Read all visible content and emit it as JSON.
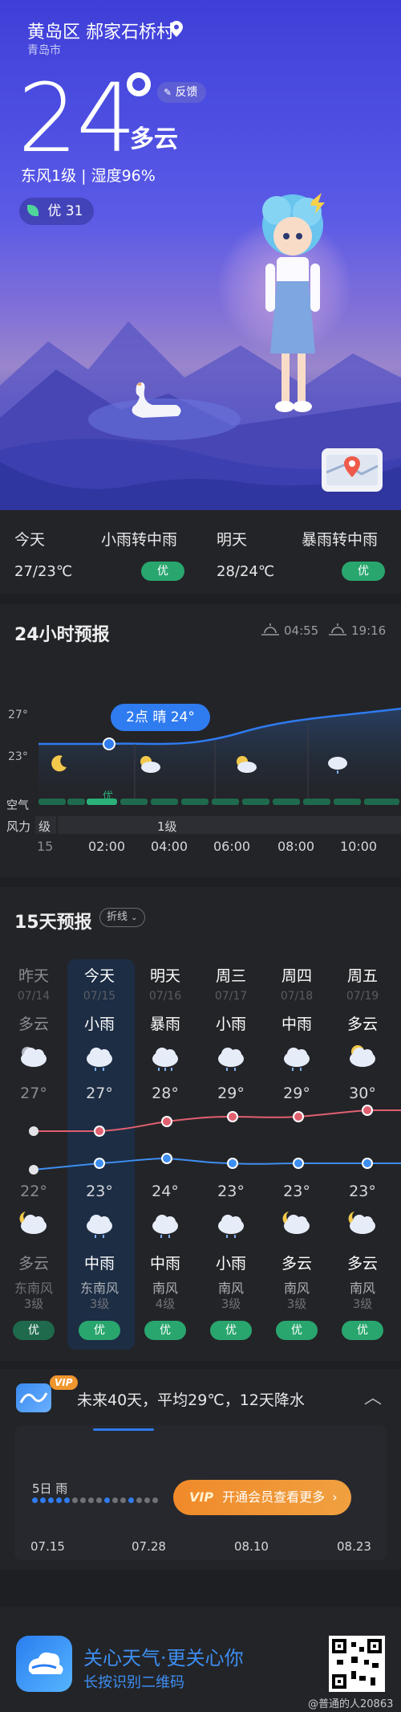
{
  "header": {
    "location": "黄岛区 郝家石桥村",
    "city": "青岛市",
    "temperature": "24",
    "condition": "多云",
    "feedback_label": "反馈",
    "wind_humidity": "东风1级 | 湿度96%",
    "aqi": "优 31"
  },
  "summary": {
    "today_label": "今天",
    "today_condition": "小雨转中雨",
    "today_temp": "27/23℃",
    "today_badge": "优",
    "tomorrow_label": "明天",
    "tomorrow_condition": "暴雨转中雨",
    "tomorrow_temp": "28/24℃",
    "tomorrow_badge": "优"
  },
  "hourly": {
    "title": "24小时预报",
    "sunrise": "04:55",
    "sunset": "19:16",
    "y_high": "27°",
    "y_low": "23°",
    "tooltip": "2点 晴 24°",
    "air_label": "空气",
    "air_value": "优",
    "wind_label": "风力",
    "wind_level_a": "级",
    "wind_level_b": "1级",
    "hours": [
      "15",
      "02:00",
      "04:00",
      "06:00",
      "08:00",
      "10:00"
    ]
  },
  "daily": {
    "title": "15天预报",
    "toggle_label": "折线",
    "days": [
      {
        "name": "昨天",
        "date": "07/14",
        "day_cond": "多云",
        "high": "27°",
        "low": "22°",
        "night_cond": "多云",
        "wind": "东南风",
        "level": "3级",
        "aqi": "优"
      },
      {
        "name": "今天",
        "date": "07/15",
        "day_cond": "小雨",
        "high": "27°",
        "low": "23°",
        "night_cond": "中雨",
        "wind": "东南风",
        "level": "3级",
        "aqi": "优"
      },
      {
        "name": "明天",
        "date": "07/16",
        "day_cond": "暴雨",
        "high": "28°",
        "low": "24°",
        "night_cond": "中雨",
        "wind": "南风",
        "level": "4级",
        "aqi": "优"
      },
      {
        "name": "周三",
        "date": "07/17",
        "day_cond": "小雨",
        "high": "29°",
        "low": "23°",
        "night_cond": "小雨",
        "wind": "南风",
        "level": "3级",
        "aqi": "优"
      },
      {
        "name": "周四",
        "date": "07/18",
        "day_cond": "中雨",
        "high": "29°",
        "low": "23°",
        "night_cond": "多云",
        "wind": "南风",
        "level": "3级",
        "aqi": "优"
      },
      {
        "name": "周五",
        "date": "07/19",
        "day_cond": "多云",
        "high": "30°",
        "low": "23°",
        "night_cond": "多云",
        "wind": "南风",
        "level": "3级",
        "aqi": "优"
      }
    ]
  },
  "forty_day": {
    "vip_badge": "VIP",
    "headline": "未来40天，平均29℃，12天降水",
    "rain_label": "5日 雨",
    "cta_vip": "VIP",
    "cta_label": "开通会员查看更多",
    "dates": [
      "07.15",
      "07.28",
      "08.10",
      "08.23"
    ]
  },
  "footer": {
    "slogan": "关心天气·更关心你",
    "hint": "长按识别二维码",
    "watermark": "@普通的人20863"
  },
  "colors": {
    "accent_blue": "#2f7bf0",
    "aqi_green": "#29a66e",
    "high_line": "#e06070",
    "low_line": "#3d8ef0",
    "vip_orange": "#f0962e"
  }
}
